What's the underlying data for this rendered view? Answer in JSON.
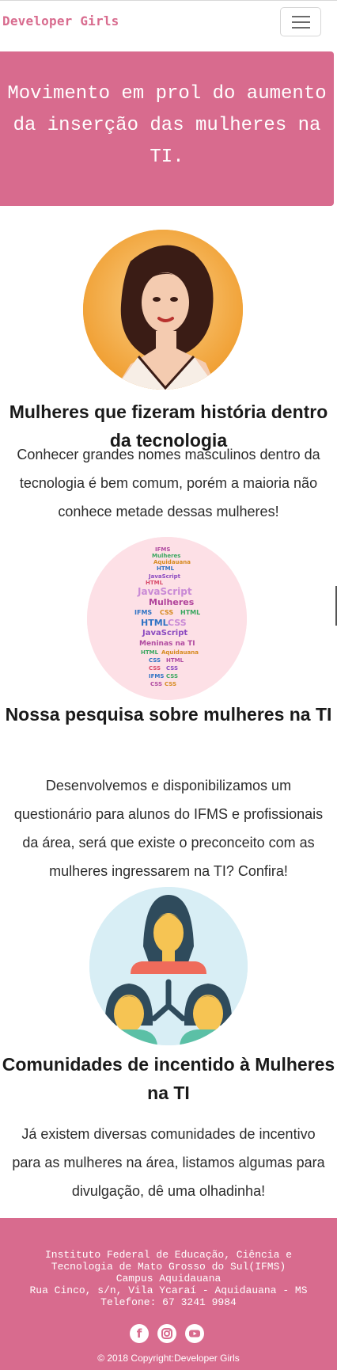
{
  "navbar": {
    "brand": "Developer Girls",
    "toggle_icon": "hamburger-menu-icon"
  },
  "hero": {
    "text": "Movimento em prol do aumento da inserção das mulheres na TI."
  },
  "cards": [
    {
      "image": "portrait-woman-illustration",
      "title": "Mulheres que fizeram história dentro da tecnologia",
      "text": "Conhecer grandes nomes masculinos dentro da tecnologia é bem comum, porém a maioria não conhece metade dessas mulheres!"
    },
    {
      "image": "word-cloud-woman-silhouette",
      "title": "Nossa pesquisa sobre mulheres na TI",
      "text": "Desenvolvemos e disponibilizamos um questionário para alunos do IFMS e profissionais da área, será que existe o preconceito com as mulheres ingressarem na TI? Confira!"
    },
    {
      "image": "women-community-network-icon",
      "title": "Comunidades de incentido à Mulheres na TI",
      "text": "Já existem diversas comunidades de incentivo para as mulheres na área, listamos algumas para divulgação, dê uma olhadinha!"
    }
  ],
  "wordcloud": {
    "words": [
      "IFMS",
      "Meninas na TI",
      "Mulheres",
      "JavaScript",
      "HTML",
      "CSS",
      "Aquidauana"
    ]
  },
  "footer": {
    "line1": "Instituto Federal de Educação, Ciência e",
    "line2": "Tecnologia de Mato Grosso do Sul(IFMS)",
    "line3": "Campus Aquidauana",
    "line4": "Rua Cinco, s/n, Vila Ycaraí - Aquidauana - MS",
    "line5": "Telefone: 67 3241 9984",
    "social": [
      "facebook-icon",
      "instagram-icon",
      "youtube-icon"
    ],
    "copyright": "© 2018 Copyright:Developer Girls"
  },
  "colors": {
    "brand": "#d86b8e",
    "text": "#212529",
    "avatar_bg_1": "#f2a93b",
    "avatar_bg_2": "#fde0e6",
    "avatar_bg_3": "#d8eef5"
  }
}
